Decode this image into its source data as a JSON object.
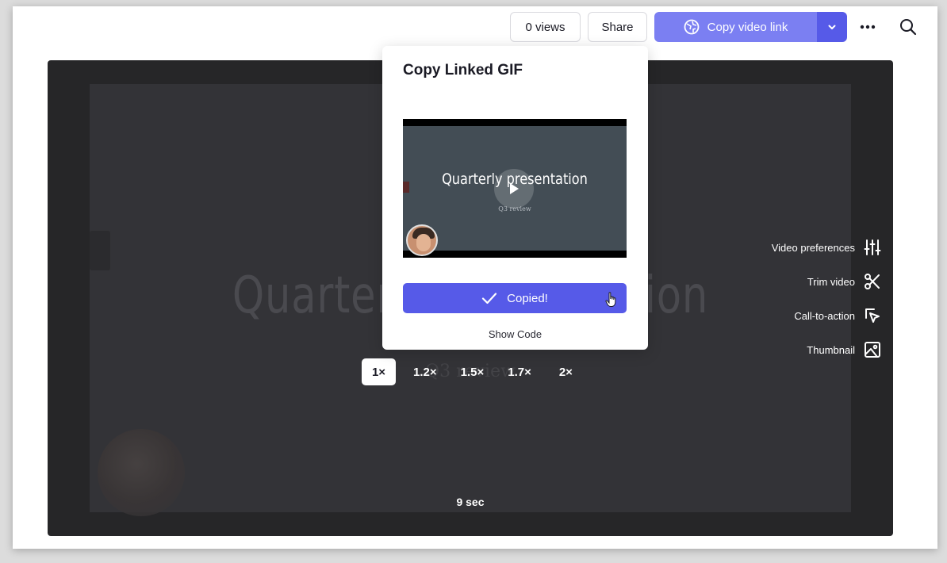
{
  "header": {
    "views_label": "0 views",
    "share_label": "Share",
    "copy_link_label": "Copy video link"
  },
  "player": {
    "slide_title": "Quarterly presentation",
    "slide_subtitle": "Q3 review",
    "speeds": [
      "1×",
      "1.2×",
      "1.5×",
      "1.7×",
      "2×"
    ],
    "active_speed": "1×",
    "duration": "9 sec",
    "side_actions": [
      {
        "label": "Video preferences",
        "icon": "sliders-icon"
      },
      {
        "label": "Trim video",
        "icon": "scissors-icon"
      },
      {
        "label": "Call-to-action",
        "icon": "cursor-click-icon"
      },
      {
        "label": "Thumbnail",
        "icon": "image-icon"
      }
    ]
  },
  "popup": {
    "title": "Copy Linked GIF",
    "preview_title": "Quarterly presentation",
    "preview_subtitle": "Q3 review",
    "copied_label": "Copied!",
    "show_code_label": "Show Code"
  },
  "colors": {
    "accent": "#565ae8",
    "accent_light": "#7b7ff2",
    "player_bg": "#262628"
  }
}
